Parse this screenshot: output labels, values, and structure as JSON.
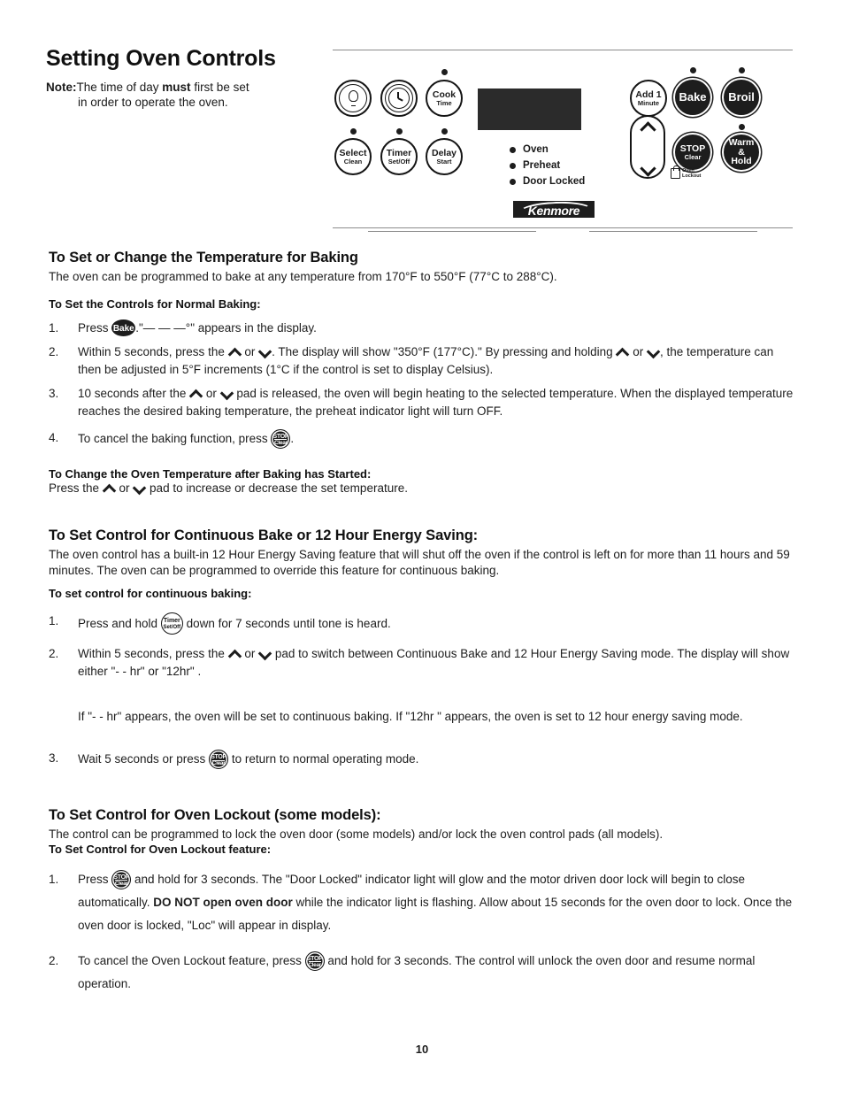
{
  "document": {
    "page_title": "Setting Oven Controls",
    "page_number": "10",
    "note": {
      "label": "Note:",
      "line1_before": "The time of day ",
      "line1_bold": "must",
      "line1_after": " first be set",
      "line2": "in order to operate the oven."
    }
  },
  "control_panel": {
    "brand_logo": "Kenmore",
    "left_keys": [
      {
        "id": "oven-light",
        "line1": "",
        "line2": "",
        "icon": "light-bulb-icon",
        "led": false
      },
      {
        "id": "clock",
        "line1": "",
        "line2": "",
        "icon": "clock-icon",
        "led": false
      },
      {
        "id": "cook-time",
        "line1": "Cook",
        "line2": "Time",
        "icon": "",
        "led": true
      },
      {
        "id": "select-clean",
        "line1": "Select",
        "line2": "Clean",
        "icon": "",
        "led": true
      },
      {
        "id": "timer-set-off",
        "line1": "Timer",
        "line2": "Set/Off",
        "icon": "",
        "led": true
      },
      {
        "id": "delay-start",
        "line1": "Delay",
        "line2": "Start",
        "icon": "",
        "led": true
      }
    ],
    "right_keys": [
      {
        "id": "add-1-minute",
        "line1": "Add 1",
        "line2": "Minute",
        "filled": false,
        "led": false
      },
      {
        "id": "bake",
        "line1": "Bake",
        "line2": "",
        "filled": true,
        "led": true
      },
      {
        "id": "broil",
        "line1": "Broil",
        "line2": "",
        "filled": true,
        "led": true
      },
      {
        "id": "stop-clear",
        "line1": "STOP",
        "line2": "Clear",
        "filled": true,
        "led": false
      },
      {
        "id": "warm-hold",
        "line1": "Warm &",
        "line2": "Hold",
        "filled": true,
        "led": true
      }
    ],
    "arrow_pad": {
      "up": "up-arrow",
      "down": "down-arrow"
    },
    "oven_lockout_mark": {
      "line1": "Oven",
      "line2": "Lockout"
    },
    "indicators": [
      "Oven",
      "Preheat",
      "Door Locked"
    ]
  },
  "sections": {
    "baking": {
      "heading": "To Set or Change the Temperature for Baking",
      "intro": "The oven can be programmed to bake at any temperature from 170°F to 550°F (77°C to 288°C).",
      "subheading": "To Set the Controls for Normal Baking:",
      "step1": {
        "num": "1.",
        "before": "Press ",
        "key": "Bake",
        "after": ".\"— — —°\" appears in the display."
      },
      "step2": {
        "num": "2.",
        "p1": "Within 5 seconds, press the ",
        "p2": " or ",
        "p3": ".  The display will show \"350°F (177°C).\" By pressing and holding ",
        "p4": " or ",
        "p5": ", the temperature can then be adjusted in 5°F increments (1°C if the control is set to display Celsius)."
      },
      "step3": {
        "num": "3.",
        "p1": "10 seconds after the ",
        "p2": " or ",
        "p3": " pad is released, the oven will begin heating to the selected temperature. When the displayed temperature reaches the desired baking temperature, the preheat indicator light will turn OFF."
      },
      "step4": {
        "num": "4.",
        "before": "To cancel the baking function, press ",
        "key_line1": "STOP",
        "key_line2": "Clear",
        "after": "."
      },
      "change_subheading": "To Change the Oven Temperature after Baking has Started:",
      "change_p1": "Press the ",
      "change_p2": " or ",
      "change_p3": " pad to increase or decrease the set temperature."
    },
    "continuous": {
      "heading": "To Set Control for Continuous Bake or 12 Hour Energy Saving:",
      "intro": "The oven control has a built-in 12 Hour Energy Saving feature that will shut off the oven if the control is left on for more than 11 hours and 59 minutes. The oven can be programmed to override this feature for continuous baking.",
      "subheading": "To set control for continuous baking:",
      "step1": {
        "num": "1.",
        "before": "Press and hold ",
        "key_line1": "Timer",
        "key_line2": "Set/Off",
        "after": " down for 7 seconds until tone is heard."
      },
      "step2": {
        "num": "2.",
        "p1": "Within 5 seconds, press the ",
        "p2": " or ",
        "p3": " pad to switch between Continuous Bake and 12 Hour Energy Saving mode. The display will show either \"- - hr\" or \"12hr\" ."
      },
      "note_para": "If \"- - hr\" appears, the oven will be set to continuous baking. If \"12hr \" appears, the oven is set to 12 hour energy saving mode.",
      "step3": {
        "num": "3.",
        "before": "Wait 5 seconds or press ",
        "key_line1": "STOP",
        "key_line2": "Clear",
        "after": " to return to normal operating mode."
      }
    },
    "lockout": {
      "heading": "To Set Control for Oven Lockout (some models):",
      "intro": "The control can be programmed to lock the oven door (some models) and/or lock the oven control pads (all models).",
      "subheading": "To Set Control for Oven Lockout feature:",
      "step1": {
        "num": "1.",
        "before": "Press ",
        "key_line1": "STOP",
        "key_line2": "Clear",
        "mid": " and hold for 3 seconds. The \"Door Locked\" indicator light will glow and the motor driven door lock will begin to close automatically. ",
        "bold": "DO NOT open oven door",
        "after": " while the indicator light is flashing. Allow about 15 seconds for the oven door to lock. Once the oven door is locked, \"Loc\" will appear in display."
      },
      "step2": {
        "num": "2.",
        "before": "To cancel the Oven Lockout feature, press ",
        "key_line1": "STOP",
        "key_line2": "Clear",
        "after": " and hold for 3 seconds. The control will unlock the oven door and resume normal operation."
      }
    }
  }
}
